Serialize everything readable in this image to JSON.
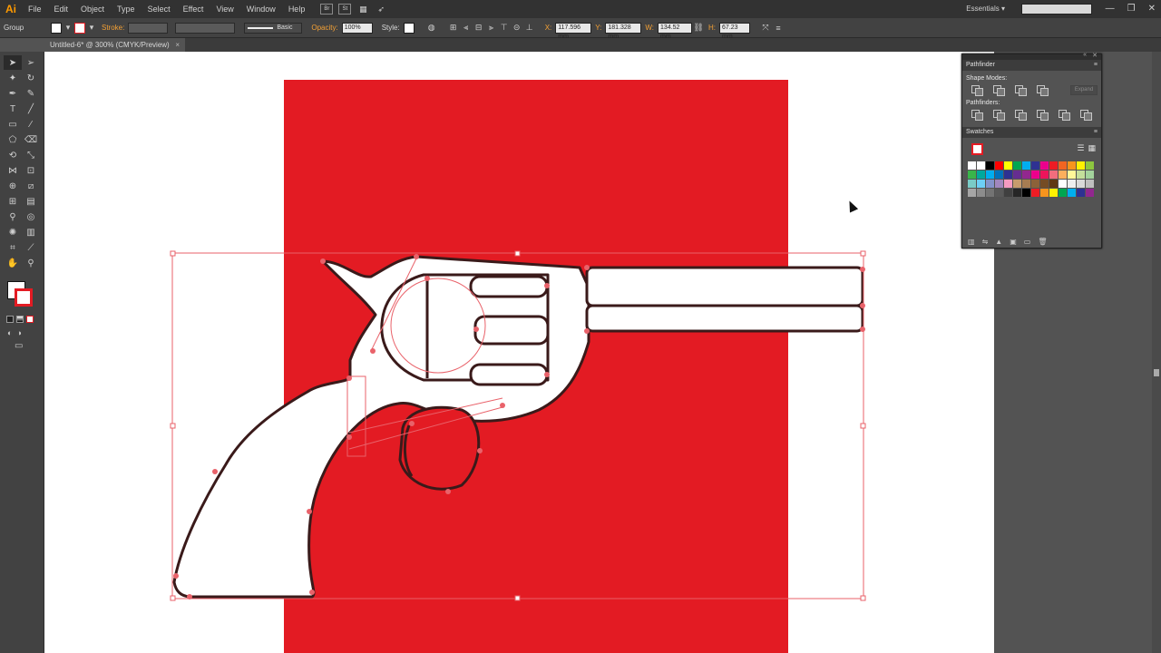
{
  "app": {
    "logo": "Ai"
  },
  "menubar": {
    "items": [
      "File",
      "Edit",
      "Object",
      "Type",
      "Select",
      "Effect",
      "View",
      "Window",
      "Help"
    ],
    "bridge_buttons": [
      "Br",
      "St"
    ],
    "workspace": "Essentials",
    "search_placeholder": ""
  },
  "controlbar": {
    "selection": "Group",
    "stroke_label": "Stroke:",
    "brush": "Basic",
    "opacity_label": "Opacity:",
    "opacity_value": "100%",
    "style_label": "Style:",
    "x_label": "X:",
    "x_value": "117.596 mm",
    "y_label": "Y:",
    "y_value": "181.328 mm",
    "w_label": "W:",
    "w_value": "134.52 mm",
    "h_label": "H:",
    "h_value": "67.23 mm"
  },
  "tab": {
    "title": "Untitled-6* @ 300% (CMYK/Preview)",
    "close": "×"
  },
  "panels": {
    "pathfinder": {
      "title": "Pathfinder",
      "shape_modes_label": "Shape Modes:",
      "pathfinders_label": "Pathfinders:",
      "expand_label": "Expand"
    },
    "swatches": {
      "title": "Swatches"
    }
  },
  "colors": {
    "accent_red": "#e31b23",
    "chrome_dark": "#323232",
    "panel": "#535353",
    "selection": "#e9626a"
  },
  "swatch_colors": [
    "#ffffff",
    "#ffffff",
    "#000000",
    "#ff0000",
    "#ffff00",
    "#00a651",
    "#00aeef",
    "#2e3192",
    "#ec008c",
    "#ed1c24",
    "#f26522",
    "#f7941d",
    "#fff200",
    "#8dc63f",
    "#39b54a",
    "#00a99d",
    "#00aeef",
    "#0072bc",
    "#2e3192",
    "#662d91",
    "#92278f",
    "#ec008c",
    "#ed145b",
    "#f26d7d",
    "#fbaf5d",
    "#fff799",
    "#c4df9b",
    "#a3d39c",
    "#7accc8",
    "#6dcff6",
    "#8393ca",
    "#a187be",
    "#f49ac1",
    "#c69c6d",
    "#a67c52",
    "#8c6239",
    "#754c24",
    "#603913",
    "#ffffff",
    "#eeeeee",
    "#d9d9d9",
    "#bfbfbf",
    "#a6a6a6",
    "#8c8c8c",
    "#737373",
    "#595959",
    "#404040",
    "#262626",
    "#000000",
    "#ed1c24",
    "#f7941d",
    "#fff200",
    "#00a651",
    "#00aeef",
    "#2e3192",
    "#92278f"
  ],
  "tools": [
    "selection-tool",
    "direct-selection-tool",
    "magic-wand-tool",
    "lasso-tool",
    "pen-tool",
    "curvature-tool",
    "type-tool",
    "line-tool",
    "rectangle-tool",
    "paintbrush-tool",
    "shaper-tool",
    "eraser-tool",
    "rotate-tool",
    "scale-tool",
    "width-tool",
    "free-transform-tool",
    "shape-builder-tool",
    "perspective-tool",
    "mesh-tool",
    "gradient-tool",
    "eyedropper-tool",
    "blend-tool",
    "symbol-sprayer-tool",
    "graph-tool",
    "artboard-tool",
    "slice-tool",
    "hand-tool",
    "zoom-tool"
  ]
}
